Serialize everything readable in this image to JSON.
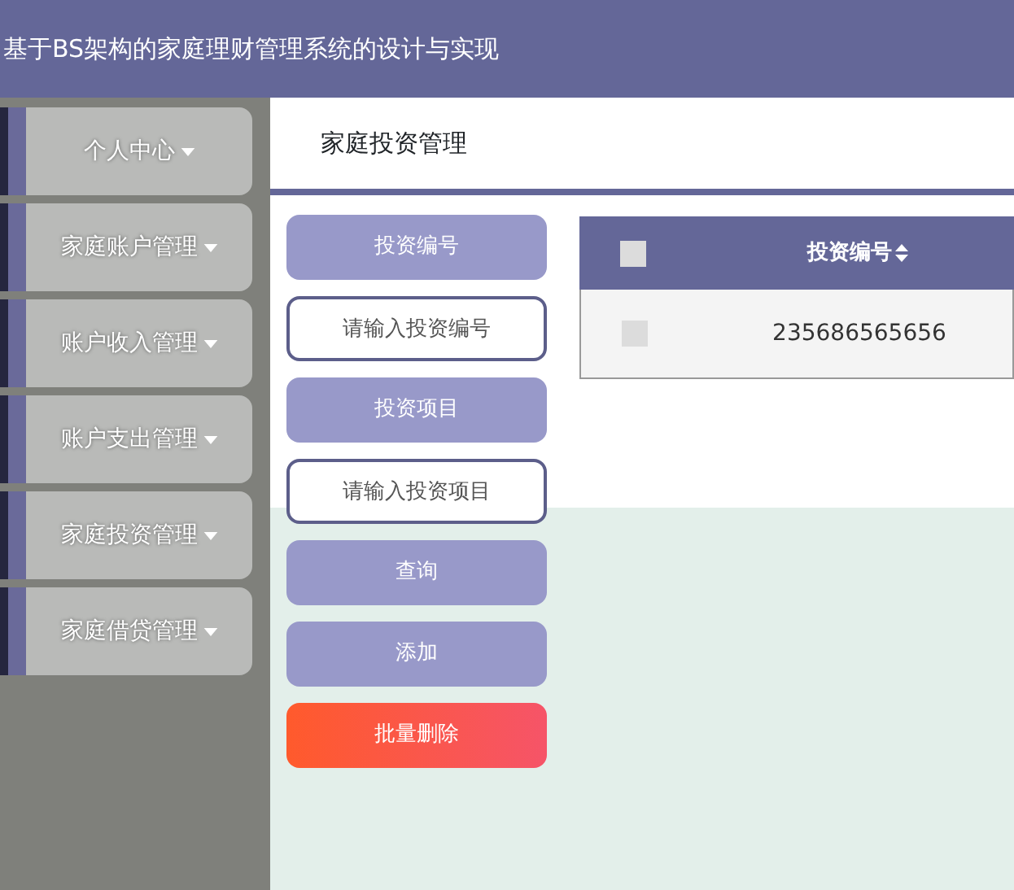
{
  "header": {
    "title": "基于BS架构的家庭理财管理系统的设计与实现"
  },
  "sidebar": {
    "items": [
      {
        "label": "个人中心",
        "expanded": false
      },
      {
        "label": "家庭账户管理",
        "expanded": false
      },
      {
        "label": "账户收入管理",
        "expanded": false
      },
      {
        "label": "账户支出管理",
        "expanded": false
      },
      {
        "label": "家庭投资管理",
        "expanded": false
      },
      {
        "label": "家庭借贷管理",
        "expanded": false
      }
    ]
  },
  "page_title": "家庭投资管理",
  "search": {
    "fields": [
      {
        "label": "投资编号",
        "placeholder": "请输入投资编号"
      },
      {
        "label": "投资项目",
        "placeholder": "请输入投资项目"
      }
    ],
    "buttons": [
      {
        "label": "查询",
        "kind": "normal"
      },
      {
        "label": "添加",
        "kind": "normal"
      },
      {
        "label": "批量删除",
        "kind": "danger"
      }
    ]
  },
  "table": {
    "header_checked": false,
    "columns": [
      {
        "label": "投资编号",
        "sortable": true
      }
    ],
    "rows": [
      {
        "checked": false,
        "cells": [
          "235686565656"
        ]
      }
    ]
  }
}
